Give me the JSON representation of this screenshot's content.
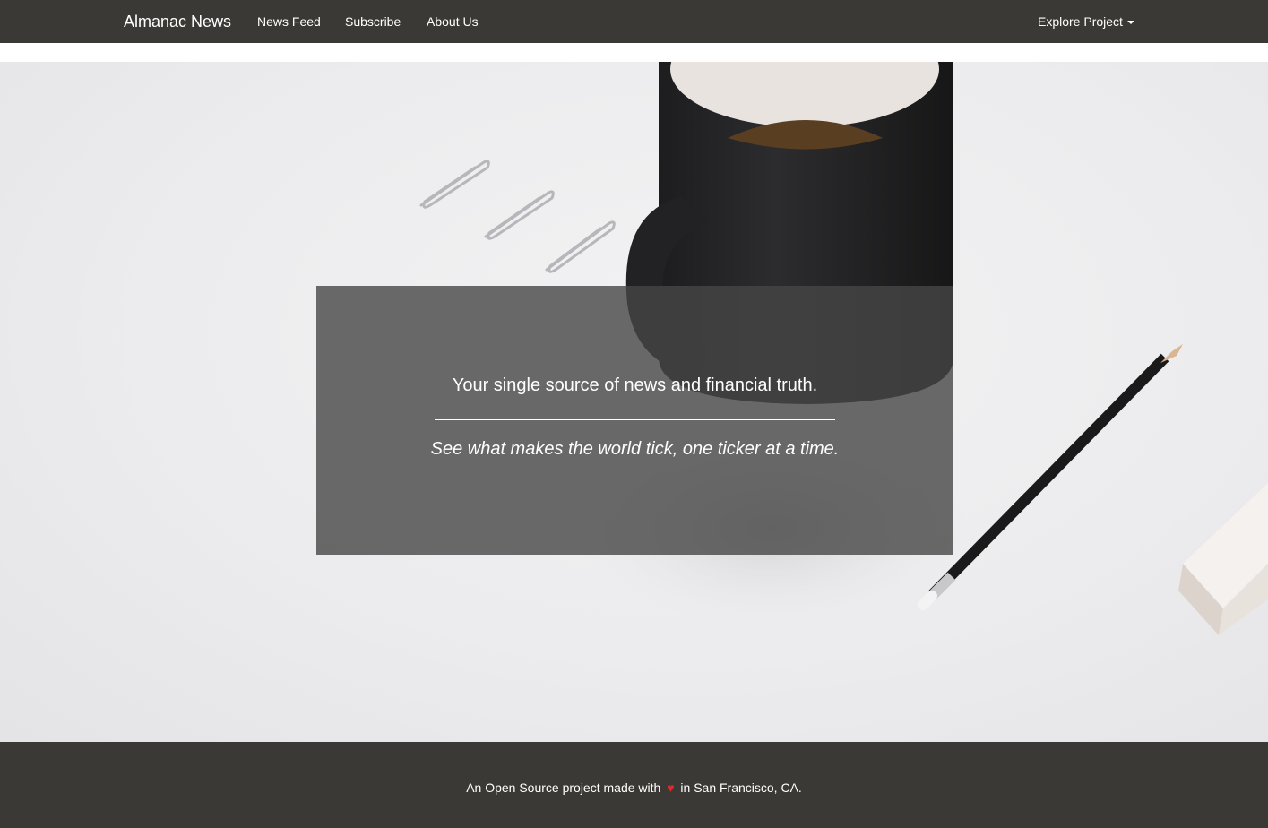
{
  "navbar": {
    "brand": "Almanac News",
    "links": [
      "News Feed",
      "Subscribe",
      "About Us"
    ],
    "dropdown_label": "Explore Project"
  },
  "hero": {
    "tagline": "Your single source of news and financial truth.",
    "subtagline": "See what makes the world tick, one ticker at a time."
  },
  "footer": {
    "text_before": "An Open Source project made with",
    "heart_glyph": "♥",
    "text_after": "in San Francisco, CA."
  },
  "colors": {
    "navbar_bg": "#3a3935",
    "footer_bg": "#3a3935",
    "heart": "#e02b2b"
  },
  "icons": [
    "caret-down-icon",
    "heart-icon"
  ]
}
